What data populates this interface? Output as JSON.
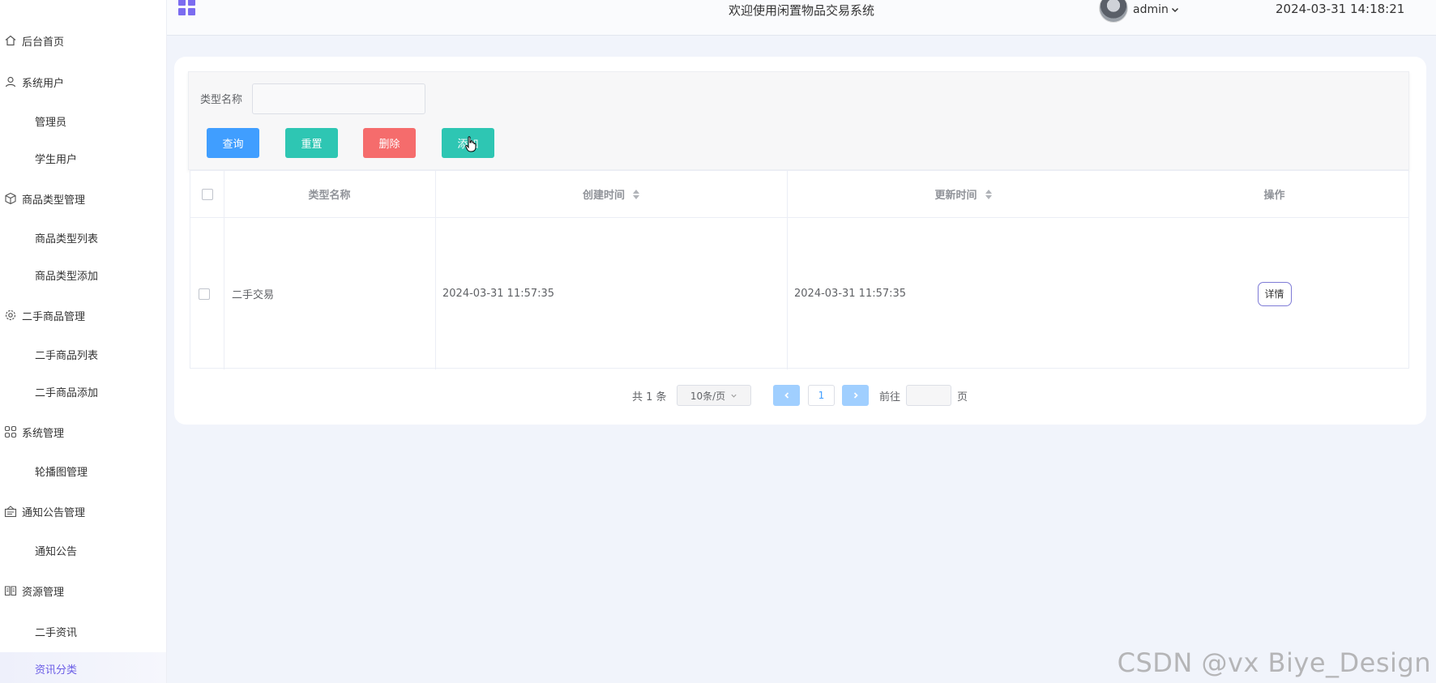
{
  "header": {
    "title": "欢迎使用闲置物品交易系统",
    "user": "admin",
    "datetime": "2024-03-31 14:18:21"
  },
  "sidebar": {
    "items": [
      {
        "type": "group",
        "icon": "home-icon",
        "label": "后台首页"
      },
      {
        "type": "group",
        "icon": "user-icon",
        "label": "系统用户"
      },
      {
        "type": "sub",
        "label": "管理员"
      },
      {
        "type": "sub",
        "label": "学生用户"
      },
      {
        "type": "group",
        "icon": "cube-icon",
        "label": "商品类型管理"
      },
      {
        "type": "sub",
        "label": "商品类型列表"
      },
      {
        "type": "sub",
        "label": "商品类型添加"
      },
      {
        "type": "group",
        "icon": "gear-icon",
        "label": "二手商品管理"
      },
      {
        "type": "sub",
        "label": "二手商品列表"
      },
      {
        "type": "sub",
        "label": "二手商品添加"
      },
      {
        "type": "group",
        "icon": "grid-icon",
        "label": "系统管理"
      },
      {
        "type": "sub",
        "label": "轮播图管理"
      },
      {
        "type": "group",
        "icon": "notice-icon",
        "label": "通知公告管理"
      },
      {
        "type": "sub",
        "label": "通知公告"
      },
      {
        "type": "group",
        "icon": "book-icon",
        "label": "资源管理"
      },
      {
        "type": "sub",
        "label": "二手资讯"
      },
      {
        "type": "sub",
        "label": "资讯分类",
        "active": true
      }
    ]
  },
  "search": {
    "label": "类型名称",
    "value": "",
    "placeholder": ""
  },
  "buttons": {
    "query": "查询",
    "reset": "重置",
    "delete": "删除",
    "add": "添加"
  },
  "table": {
    "columns": [
      "类型名称",
      "创建时间",
      "更新时间",
      "操作"
    ],
    "rows": [
      {
        "name": "二手交易",
        "created": "2024-03-31 11:57:35",
        "updated": "2024-03-31 11:57:35",
        "action": "详情"
      }
    ]
  },
  "pagination": {
    "total": "共 1 条",
    "page_size": "10条/页",
    "current_page": "1",
    "goto_prefix": "前往",
    "goto_suffix": "页"
  },
  "watermark": "CSDN @vx Biye_Design",
  "colors": {
    "primary": "#409eff",
    "teal": "#2ec6b3",
    "danger": "#f56c6c",
    "accent": "#6a5ce6"
  }
}
